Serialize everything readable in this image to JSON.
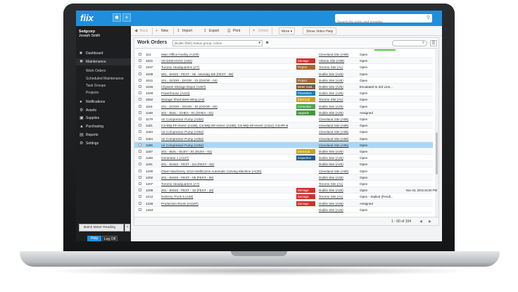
{
  "app": {
    "logo": "fiix"
  },
  "topbar": {
    "search_placeholder": "Search for parts and supplies",
    "user_icon": "user-icon",
    "add_icon": "plus-icon"
  },
  "sidebar": {
    "org": "Sedgcorp",
    "user": "Joseph Smith",
    "nav": [
      {
        "label": "Dashboard",
        "icon": "dashboard-icon"
      },
      {
        "label": "Maintenance",
        "icon": "wrench-icon"
      }
    ],
    "sub": [
      "Work Orders",
      "Scheduled Maintenance",
      "Task Groups",
      "Projects"
    ],
    "nav2": [
      {
        "label": "Notifications",
        "icon": "bell-icon"
      },
      {
        "label": "Assets",
        "icon": "gears-icon"
      },
      {
        "label": "Supplies",
        "icon": "box-icon"
      },
      {
        "label": "Purchasing",
        "icon": "cart-icon"
      },
      {
        "label": "Reports",
        "icon": "chart-icon"
      },
      {
        "label": "Settings",
        "icon": "gear-icon"
      }
    ],
    "batch_meter": "Batch Meter Reading",
    "help": "Help",
    "logoff": "Log Off"
  },
  "toolbar": {
    "back": "Back",
    "new": "New",
    "import": "Import",
    "export": "Export",
    "print": "Print",
    "delete": "Delete",
    "more": "More",
    "video": "Show Video Help"
  },
  "work_orders": {
    "title": "Work Orders",
    "filter": "[Builtin filter] Status group: Active",
    "pager": "1 - 60 of 104"
  },
  "tag_colors": {
    "Damage": "#d0302b",
    "Project": "#a8662f",
    "Meter read...": "#7b5a3d",
    "Preventive": "#1f7fb8",
    "Electrical": "#c7a51e",
    "Corrective": "#4aa84a",
    "Upgrade": "#3f9a3a",
    "Inspection": "#1e5c96"
  },
  "rows": [
    {
      "num": "114",
      "asset": "Main Office Facility (A100)",
      "tag": "",
      "site": "Cleveland Site (A99)",
      "status": "Open",
      "date": ""
    },
    {
      "num": "1021",
      "asset": "A5-SSW-HVAC (A81)",
      "tag": "Damage",
      "site": "Atlanta Site (A99)",
      "status": "Open",
      "date": ""
    },
    {
      "num": "1037",
      "asset": "Toronto Headquarters (A7)",
      "tag": "Project",
      "site": "Toronto Site (A1)",
      "status": "Open",
      "date": ""
    },
    {
      "num": "1039",
      "asset": "201 - EHSS - FEXT - 06 - Monday 6th (FEXT - 06)",
      "tag": "",
      "site": "Dublin Site (A25)",
      "status": "Open",
      "date": ""
    },
    {
      "num": "1041",
      "asset": "201 - DOOR - DOOR - 03 (DOOR - 03)",
      "tag": "Project",
      "site": "Dublin Site (A25)",
      "status": "Open",
      "date": ""
    },
    {
      "num": "1046",
      "asset": "Citywest Storage Depot (A457)",
      "tag": "Meter read...",
      "site": "Dublin Site (A25)",
      "status": "Escalated to 3rd Line...",
      "date": ""
    },
    {
      "num": "1049",
      "asset": "Powerhouse (A223)",
      "tag": "Preventive",
      "site": "Dublin Site (A25)",
      "status": "Open",
      "date": ""
    },
    {
      "num": "1062",
      "asset": "Storage Shed West Wing (A2)",
      "tag": "Electrical",
      "site": "Toronto Site (A1)",
      "status": "Open",
      "date": ""
    },
    {
      "num": "1115",
      "asset": "201 - DOOR - DOOR - 02 (DOOR - 02)",
      "tag": "Corrective",
      "site": "Dublin Site (A25)",
      "status": "Open",
      "date": ""
    },
    {
      "num": "1169",
      "asset": "201 - BUIL - GHEA - 01 (GHEA - 01)",
      "tag": "Upgrade",
      "site": "Dublin Site (A25)",
      "status": "Assigned",
      "date": ""
    },
    {
      "num": "1179",
      "asset": "Air Compressor Pump (A354)",
      "tag": "",
      "site": "Cleveland Site (A99)",
      "status": "Open",
      "date": ""
    },
    {
      "num": "1181",
      "asset": "CS-MQ-FF-HVAC (A108), CS-MQ-GF-HVAC (A109), CS-MQ-SF-HVAC (A111), CS-PF-B...",
      "tag": "",
      "site": "Cleveland Site (A99)",
      "status": "Open",
      "date": ""
    },
    {
      "num": "1183",
      "asset": "Air Compressor Pump (A354)",
      "tag": "",
      "site": "Cleveland Site (A99)",
      "status": "Open",
      "date": ""
    },
    {
      "num": "1184",
      "asset": "Air Compressor Pump (A354)",
      "tag": "",
      "site": "Cleveland Site (A99)",
      "status": "Open",
      "date": ""
    },
    {
      "num": "1185",
      "asset": "Air Compressor Pump (A354)",
      "tag": "",
      "site": "Cleveland Site (A99)",
      "status": "Open",
      "date": ""
    },
    {
      "num": "1187",
      "asset": "201 - BUIL - ELEV - 01 (ELEV - 01)",
      "tag": "Electrical",
      "site": "Dublin Site (A25)",
      "status": "Open",
      "date": ""
    },
    {
      "num": "1188",
      "asset": "Generator 1 (A227)",
      "tag": "Inspection",
      "site": "Dublin Site (A25)",
      "status": "Open",
      "date": ""
    },
    {
      "num": "1191",
      "asset": "201 - EHSS - FEXT - D4 (FEXT - 04)",
      "tag": "",
      "site": "Dublin Site (A25)",
      "status": "Open",
      "date": ""
    },
    {
      "num": "1200",
      "asset": "Oliver Machinery 1013 IntelliCarve Automatic Carving Machine (A130)",
      "tag": "",
      "site": "Cleveland Site (A99)",
      "status": "Open",
      "date": ""
    },
    {
      "num": "1202",
      "asset": "201 - EHSS - FEXT - 05 (FEXT - 05)",
      "tag": "",
      "site": "Dublin Site (A25)",
      "status": "Open",
      "date": ""
    },
    {
      "num": "1207",
      "asset": "Toronto Headquarters (A7)",
      "tag": "",
      "site": "Toronto Site (A1)",
      "status": "Open",
      "date": ""
    },
    {
      "num": "1209",
      "asset": "201 - EHSS - FEXT - 10 (FEXT - 10)",
      "tag": "Damage",
      "site": "Dublin Site (A25)",
      "status": "Open",
      "date": "Nov 03, 2015 04:00 PM"
    },
    {
      "num": "1212",
      "asset": "Delivery Truck 6 (A28)",
      "tag": "Damage",
      "site": "Toronto Site (A1)",
      "status": "Open - Stalled (Pendi...",
      "date": ""
    },
    {
      "num": "1228",
      "asset": "Production Room (A1197)",
      "tag": "Damage",
      "site": "Dublin Site (A25)",
      "status": "Assigned",
      "date": ""
    },
    {
      "num": "1253",
      "asset": "",
      "tag": "",
      "site": "Dublin Site (A25)",
      "status": "Open",
      "date": ""
    }
  ]
}
